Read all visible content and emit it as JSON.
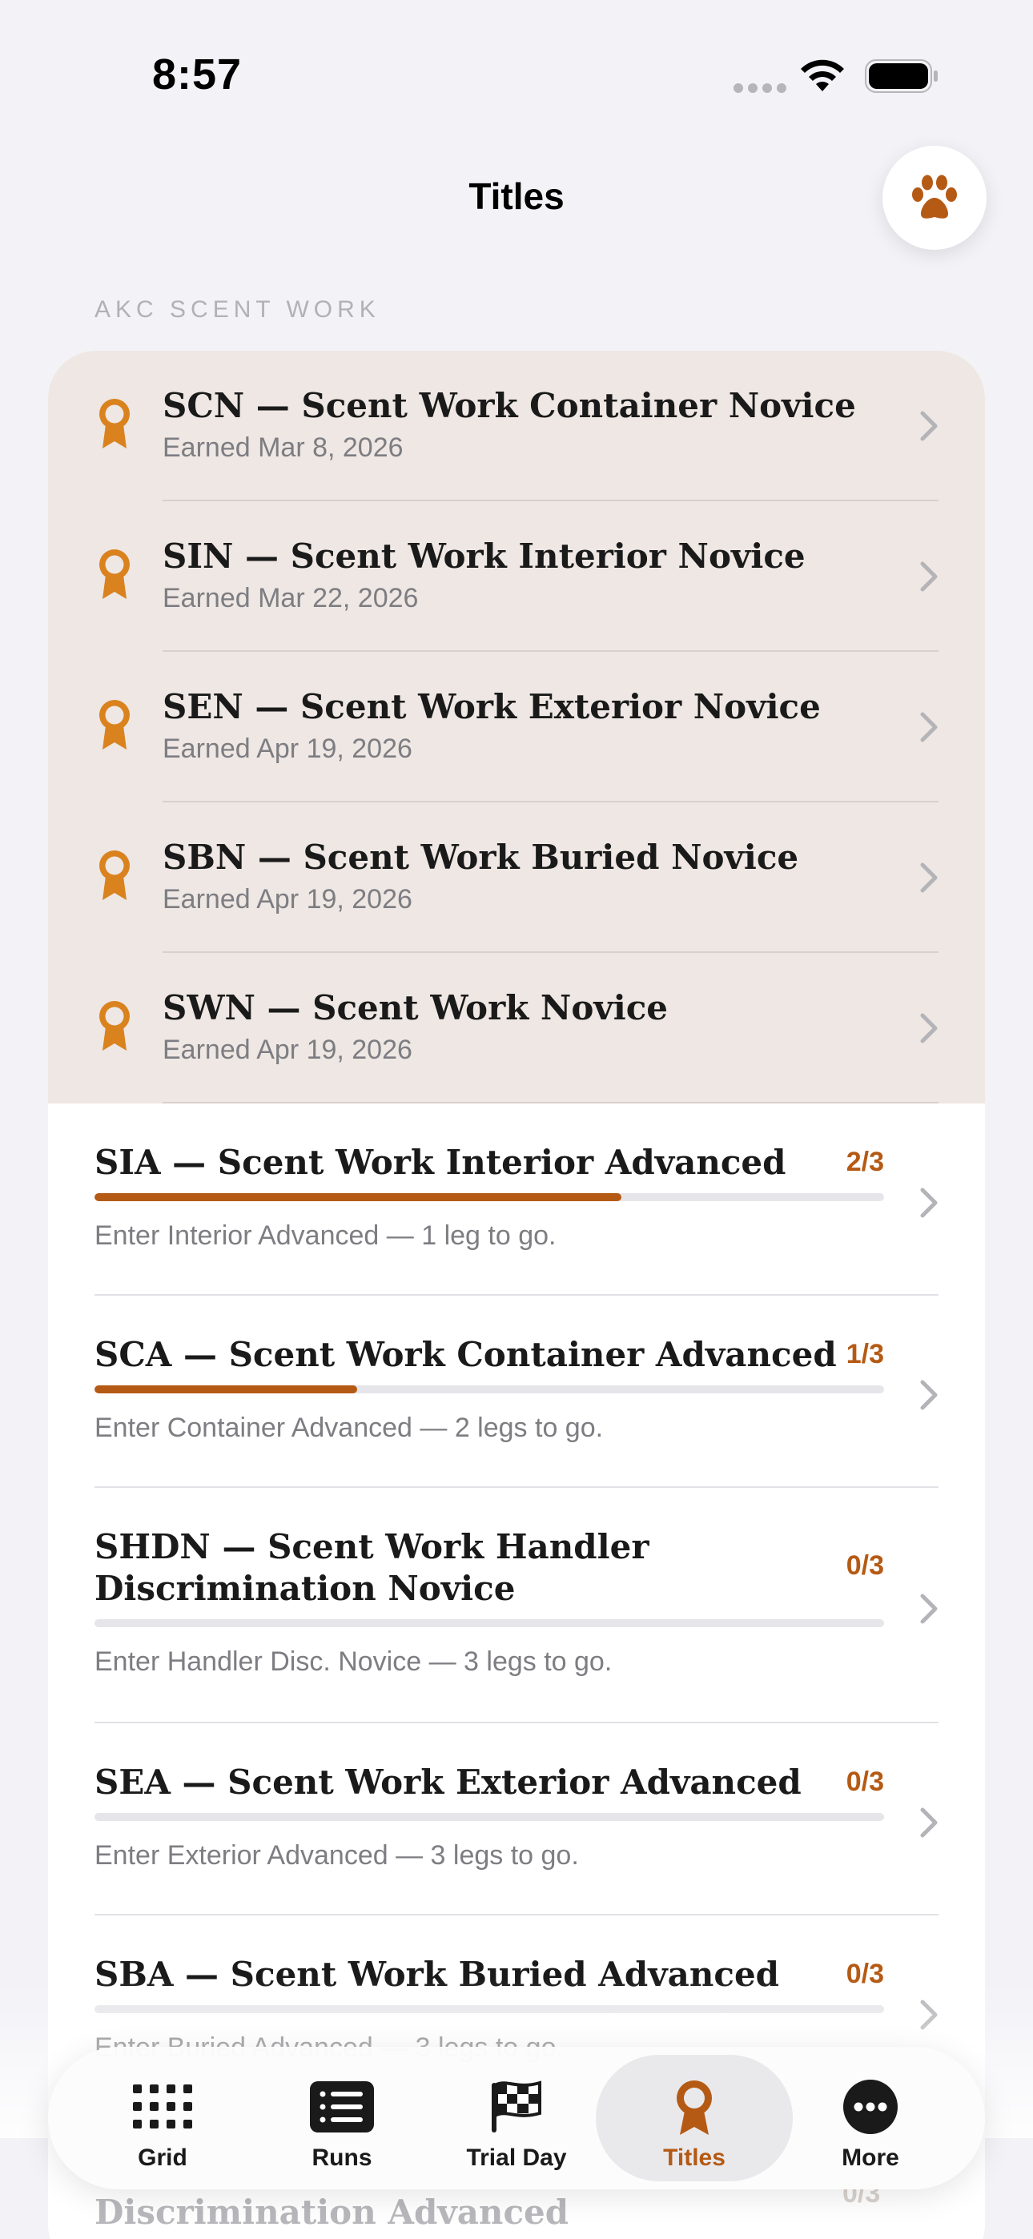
{
  "status_bar": {
    "time": "8:57"
  },
  "nav": {
    "title": "Titles",
    "action_icon": "paw-icon"
  },
  "colors": {
    "accent": "#b55a14",
    "ribbon": "#d9821e",
    "earned_bg": "#eee7e3",
    "page_bg": "#f2f2f7"
  },
  "section": {
    "header": "AKC SCENT WORK"
  },
  "earned_titles": [
    {
      "title": "SCN — Scent Work Container Novice",
      "subtitle": "Earned Mar 8, 2026"
    },
    {
      "title": "SIN — Scent Work Interior Novice",
      "subtitle": "Earned Mar 22, 2026"
    },
    {
      "title": "SEN — Scent Work Exterior Novice",
      "subtitle": "Earned Apr 19, 2026"
    },
    {
      "title": "SBN — Scent Work Buried Novice",
      "subtitle": "Earned Apr 19, 2026"
    },
    {
      "title": "SWN — Scent Work Novice",
      "subtitle": "Earned Apr 19, 2026"
    }
  ],
  "progress_titles": [
    {
      "title": "SIA — Scent Work Interior Advanced",
      "count": "2/3",
      "progress": 0.667,
      "subtitle": "Enter Interior Advanced — 1 leg to go."
    },
    {
      "title": "SCA — Scent Work Container Advanced",
      "count": "1/3",
      "progress": 0.333,
      "subtitle": "Enter Container Advanced — 2 legs to go."
    },
    {
      "title": "SHDN — Scent Work Handler Discrimination Novice",
      "title_line1": "SHDN — Scent Work Handler",
      "title_line2": "Discrimination Novice",
      "count": "0/3",
      "progress": 0,
      "subtitle": "Enter Handler Disc. Novice — 3 legs to go."
    },
    {
      "title": "SEA — Scent Work Exterior Advanced",
      "count": "0/3",
      "progress": 0,
      "subtitle": "Enter Exterior Advanced — 3 legs to go."
    },
    {
      "title": "SBA — Scent Work Buried Advanced",
      "count": "0/3",
      "progress": 0,
      "subtitle": "Enter Buried Advanced — 3 legs to go."
    }
  ],
  "peek_row": {
    "title": "Discrimination Advanced",
    "count": "0/3"
  },
  "tab_bar": {
    "tabs": [
      {
        "label": "Grid",
        "icon": "grid-icon"
      },
      {
        "label": "Runs",
        "icon": "list-icon"
      },
      {
        "label": "Trial Day",
        "icon": "checkered-flag-icon"
      },
      {
        "label": "Titles",
        "icon": "ribbon-icon",
        "active": true
      },
      {
        "label": "More",
        "icon": "more-icon"
      }
    ]
  }
}
